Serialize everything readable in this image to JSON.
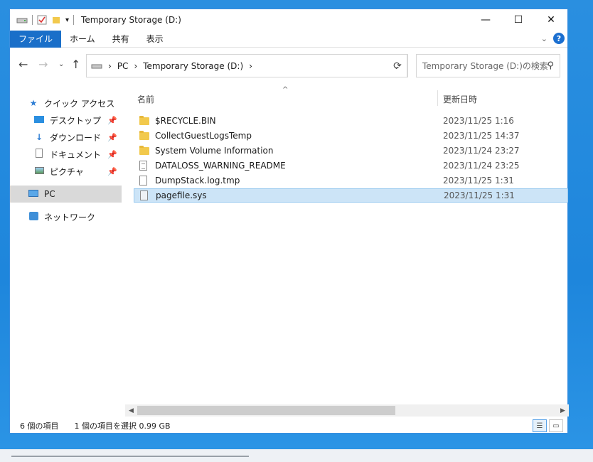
{
  "window": {
    "title": "Temporary Storage (D:)",
    "controls": {
      "minimize": "—",
      "maximize": "☐",
      "close": "✕"
    }
  },
  "ribbon": {
    "tabs": [
      "ファイル",
      "ホーム",
      "共有",
      "表示"
    ],
    "help": "?"
  },
  "address": {
    "crumbs": [
      "PC",
      "Temporary Storage (D:)"
    ],
    "separator": "›",
    "search_placeholder": "Temporary Storage (D:)の検索"
  },
  "nav": {
    "quick_access": "クイック アクセス",
    "items": [
      "デスクトップ",
      "ダウンロード",
      "ドキュメント",
      "ピクチャ"
    ],
    "pc": "PC",
    "network": "ネットワーク"
  },
  "columns": {
    "name": "名前",
    "date": "更新日時"
  },
  "files": [
    {
      "name": "$RECYCLE.BIN",
      "date": "2023/11/25 1:16",
      "type": "folder"
    },
    {
      "name": "CollectGuestLogsTemp",
      "date": "2023/11/25 14:37",
      "type": "folder"
    },
    {
      "name": "System Volume Information",
      "date": "2023/11/24 23:27",
      "type": "folder"
    },
    {
      "name": "DATALOSS_WARNING_README",
      "date": "2023/11/24 23:25",
      "type": "text"
    },
    {
      "name": "DumpStack.log.tmp",
      "date": "2023/11/25 1:31",
      "type": "file"
    },
    {
      "name": "pagefile.sys",
      "date": "2023/11/25 1:31",
      "type": "system"
    }
  ],
  "status": {
    "count": "6 個の項目",
    "selected": "1 個の項目を選択  0.99 GB"
  },
  "colors": {
    "accent": "#1a6fc9",
    "selection": "#cce4f7",
    "desktop": "#1e86dc"
  }
}
